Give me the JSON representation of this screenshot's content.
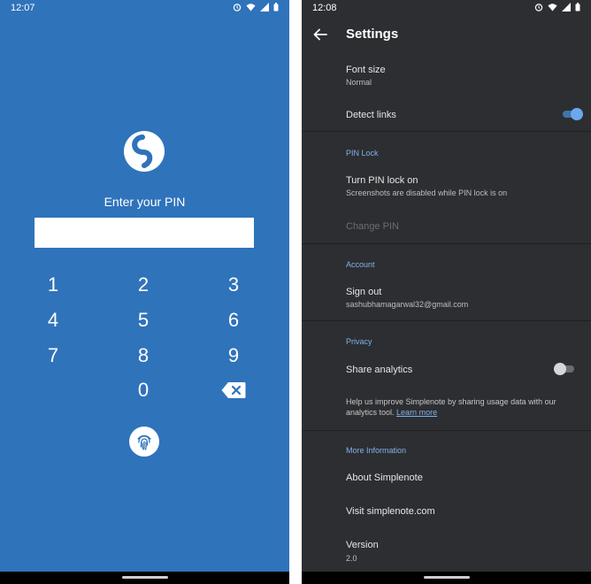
{
  "pin_screen": {
    "status": {
      "time": "12:07"
    },
    "prompt": "Enter your PIN",
    "keypad": [
      "1",
      "2",
      "3",
      "4",
      "5",
      "6",
      "7",
      "8",
      "9",
      "0"
    ],
    "icons": {
      "logo": "simplenote-logo-icon",
      "backspace": "backspace-icon",
      "fingerprint": "fingerprint-icon"
    }
  },
  "settings_screen": {
    "status": {
      "time": "12:08"
    },
    "title": "Settings",
    "font_size": {
      "label": "Font size",
      "value": "Normal"
    },
    "detect_links": {
      "label": "Detect links",
      "enabled": true
    },
    "pin_lock": {
      "section": "PIN Lock",
      "turn_on_label": "Turn PIN lock on",
      "turn_on_sub": "Screenshots are disabled while PIN lock is on",
      "change_pin": "Change PIN"
    },
    "account": {
      "section": "Account",
      "sign_out": "Sign out",
      "email": "sashubhamagarwal32@gmail.com"
    },
    "privacy": {
      "section": "Privacy",
      "share_analytics": "Share analytics",
      "share_enabled": false,
      "help_text": "Help us improve Simplenote by sharing usage data with our analytics tool.",
      "learn_more": "Learn more"
    },
    "more_info": {
      "section": "More Information",
      "about": "About Simplenote",
      "visit": "Visit simplenote.com",
      "version_label": "Version",
      "version_value": "2.0"
    }
  },
  "colors": {
    "pin_background": "#2f73bb",
    "settings_background": "#2d2e32",
    "accent": "#7fb3ea"
  }
}
